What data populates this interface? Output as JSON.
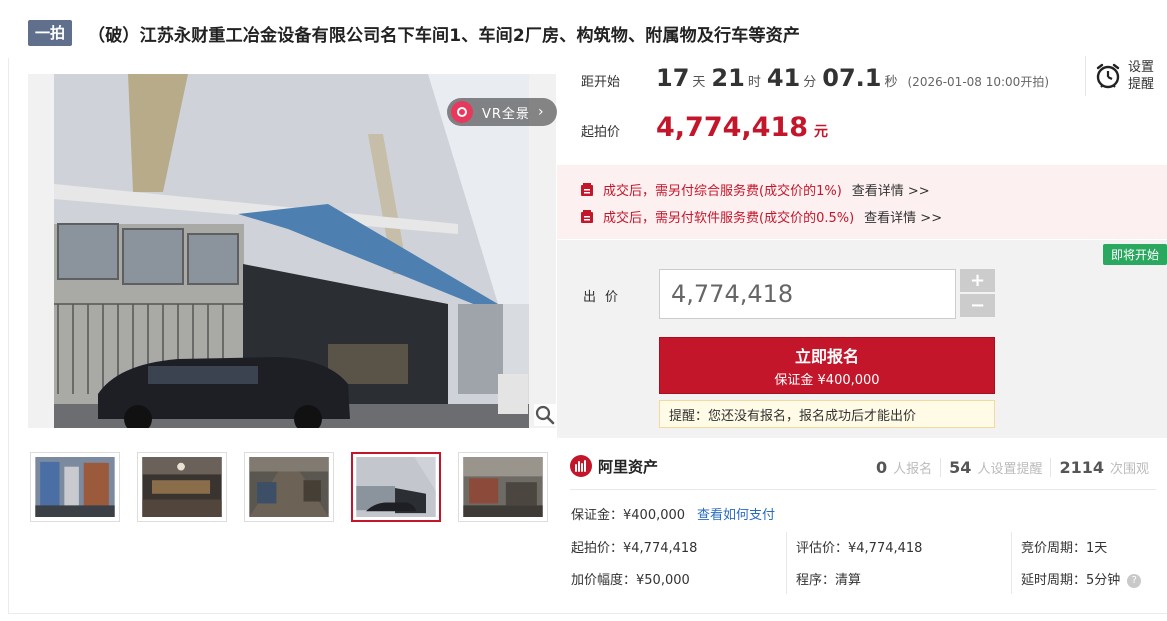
{
  "header": {
    "tag": "一拍",
    "title": "（破）江苏永财重工冶金设备有限公司名下车间1、车间2厂房、构筑物、附属物及行车等资产"
  },
  "gallery": {
    "vr_label": "VR全景",
    "vr_arrow": "›",
    "thumbnail_count": 5,
    "active_thumbnail": 4
  },
  "countdown": {
    "label": "距开始",
    "days": "17",
    "days_unit": "天",
    "hours": "21",
    "hours_unit": "时",
    "minutes": "41",
    "minutes_unit": "分",
    "seconds": "07.1",
    "seconds_unit": "秒",
    "start_note": "(2026-01-08 10:00开拍)"
  },
  "reminder": {
    "line1": "设置",
    "line2": "提醒"
  },
  "start_price": {
    "label": "起拍价",
    "value": "4,774,418",
    "unit": "元"
  },
  "fees": [
    {
      "text": "成交后，需另付综合服务费(成交价的1%)",
      "link": "查看详情 >>"
    },
    {
      "text": "成交后，需另付软件服务费(成交价的0.5%)",
      "link": "查看详情 >>"
    }
  ],
  "bid": {
    "badge": "即将开始",
    "label": "出价",
    "input_value": "4,774,418",
    "plus": "+",
    "minus": "−",
    "signup_main": "立即报名",
    "signup_sub": "保证金 ¥400,000",
    "tip": "提醒：您还没有报名，报名成功后才能出价"
  },
  "brand": {
    "name": "阿里资产"
  },
  "stats": [
    {
      "num": "0",
      "label": "人报名"
    },
    {
      "num": "54",
      "label": "人设置提醒"
    },
    {
      "num": "2114",
      "label": "次围观"
    }
  ],
  "deposit": {
    "text": "保证金：¥400,000",
    "link": "查看如何支付"
  },
  "info": {
    "start_price": "起拍价：¥4,774,418",
    "increment": "加价幅度：¥50,000",
    "appraisal": "评估价：¥4,774,418",
    "procedure": "程序：清算",
    "cycle": "竞价周期：1天",
    "delay": "延时周期：5分钟",
    "help": "?"
  },
  "colors": {
    "accent": "#c4162b",
    "tag_bg": "#5f6f8c",
    "soon_green": "#2aa85f",
    "link_blue": "#2a6bbf"
  }
}
